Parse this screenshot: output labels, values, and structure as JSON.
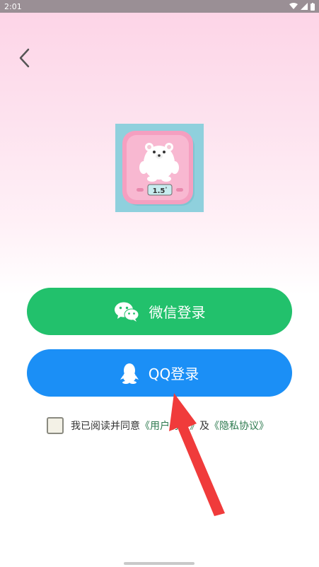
{
  "status_bar": {
    "time": "2:01"
  },
  "header": {
    "back_icon": "chevron-left-icon"
  },
  "app_icon": {
    "scale_reading": "1.5",
    "scale_unit": "°"
  },
  "buttons": {
    "wechat_label": "微信登录",
    "qq_label": "QQ登录"
  },
  "agreement": {
    "prefix": "我已阅读并同意",
    "user_agreement": "《用户协议》",
    "and": "及",
    "privacy_policy": "《隐私协议》",
    "checked": false
  },
  "colors": {
    "wechat": "#22c16c",
    "qq": "#1b8ff6",
    "link": "#2e7a4f",
    "arrow": "#f03b3b"
  }
}
